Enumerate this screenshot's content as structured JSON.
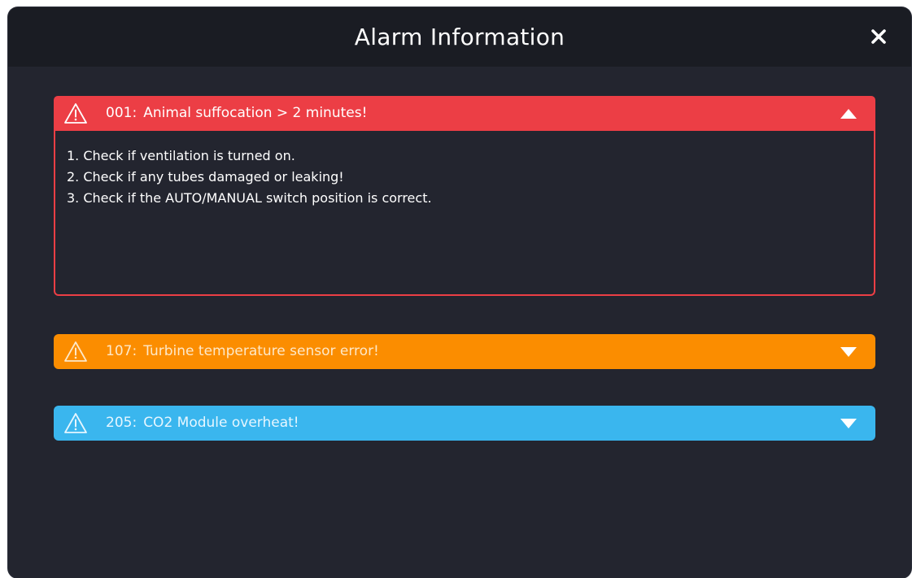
{
  "dialog": {
    "title": "Alarm Information",
    "close_icon": "close-icon"
  },
  "alarms": [
    {
      "code": "001",
      "separator": ":",
      "message": "Animal suffocation > 2 minutes!",
      "color": "#ec3e45",
      "text_color": "#ffffff",
      "expanded": true,
      "caret_icon": "caret-up-icon",
      "steps": [
        "1. Check if ventilation is turned on.",
        "2. Check if any tubes damaged or leaking!",
        "3. Check if the AUTO/MANUAL switch position is correct."
      ]
    },
    {
      "code": "107",
      "separator": ":",
      "message": "Turbine temperature sensor error!",
      "color": "#fb8d00",
      "text_color": "#fde8c8",
      "expanded": false,
      "caret_icon": "caret-down-icon"
    },
    {
      "code": "205",
      "separator": ":",
      "message": "CO2 Module overheat!",
      "color": "#3ab6ee",
      "text_color": "#e6f6ff",
      "expanded": false,
      "caret_icon": "caret-down-icon"
    }
  ],
  "colors": {
    "dialog_bg": "#23252f",
    "title_bar_bg": "#1a1c23"
  }
}
